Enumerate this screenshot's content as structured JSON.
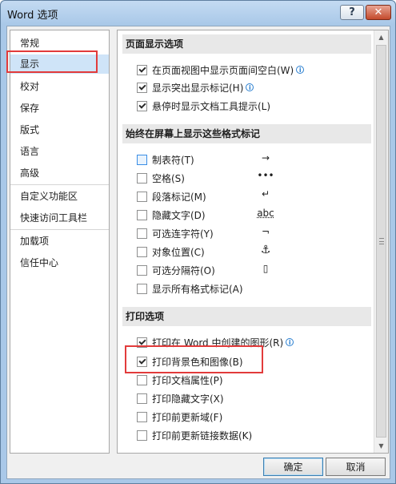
{
  "window": {
    "title": "Word 选项",
    "help_label": "?",
    "close_label": "✕"
  },
  "sidebar": {
    "items": [
      {
        "label": "常规"
      },
      {
        "label": "显示"
      },
      {
        "label": "校对"
      },
      {
        "label": "保存"
      },
      {
        "label": "版式"
      },
      {
        "label": "语言"
      },
      {
        "label": "高级"
      },
      {
        "label": "自定义功能区"
      },
      {
        "label": "快速访问工具栏"
      },
      {
        "label": "加载项"
      },
      {
        "label": "信任中心"
      }
    ]
  },
  "sections": {
    "page_display": {
      "header": "页面显示选项",
      "options": [
        {
          "label": "在页面视图中显示页面间空白(W)",
          "checked": true
        },
        {
          "label": "显示突出显示标记(H)",
          "checked": true
        },
        {
          "label": "悬停时显示文档工具提示(L)",
          "checked": true
        }
      ]
    },
    "format_marks": {
      "header": "始终在屏幕上显示这些格式标记",
      "options": [
        {
          "label": "制表符(T)",
          "checked": false,
          "glyph": "→"
        },
        {
          "label": "空格(S)",
          "checked": false,
          "glyph": "•••"
        },
        {
          "label": "段落标记(M)",
          "checked": false,
          "glyph": "↵"
        },
        {
          "label": "隐藏文字(D)",
          "checked": false,
          "glyph": "abc"
        },
        {
          "label": "可选连字符(Y)",
          "checked": false,
          "glyph": "¬"
        },
        {
          "label": "对象位置(C)",
          "checked": false,
          "glyph": "⚓"
        },
        {
          "label": "可选分隔符(O)",
          "checked": false,
          "glyph": "▯"
        },
        {
          "label": "显示所有格式标记(A)",
          "checked": false
        }
      ]
    },
    "print": {
      "header": "打印选项",
      "options": [
        {
          "label": "打印在 Word 中创建的图形(R)",
          "checked": true
        },
        {
          "label": "打印背景色和图像(B)",
          "checked": true
        },
        {
          "label": "打印文档属性(P)",
          "checked": false
        },
        {
          "label": "打印隐藏文字(X)",
          "checked": false
        },
        {
          "label": "打印前更新域(F)",
          "checked": false
        },
        {
          "label": "打印前更新链接数据(K)",
          "checked": false
        }
      ]
    }
  },
  "footer": {
    "ok_label": "确定",
    "cancel_label": "取消"
  },
  "colors": {
    "highlight_box": "#e23b3b",
    "selected_nav": "#cfe4f8"
  }
}
